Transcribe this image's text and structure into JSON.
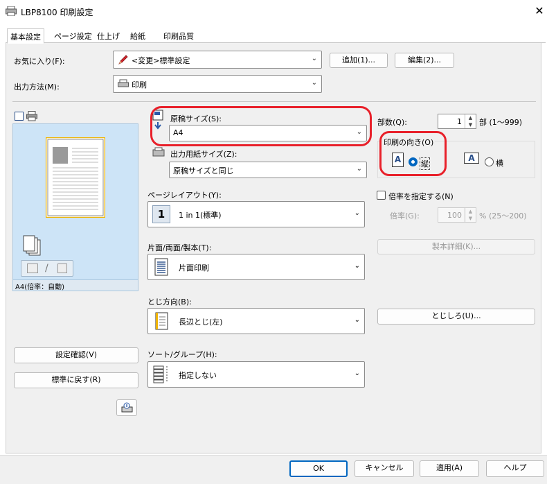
{
  "window": {
    "title": "LBP8100 印刷設定",
    "close_symbol": "✕"
  },
  "tabs": [
    "基本設定",
    "ページ設定",
    "仕上げ",
    "給紙",
    "印刷品質"
  ],
  "favorites": {
    "label": "お気に入り(F):",
    "value": "<変更>標準設定",
    "add_button": "追加(1)...",
    "edit_button": "編集(2)..."
  },
  "output_method": {
    "label": "出力方法(M):",
    "value": "印刷"
  },
  "preview": {
    "caption": "A4(倍率：自動)",
    "n_up_icons": "/ "
  },
  "left_buttons": {
    "confirm": "設定確認(V)",
    "restore": "標準に戻す(R)"
  },
  "paper": {
    "original_size_label": "原稿サイズ(S):",
    "original_size_value": "A4",
    "output_size_label": "出力用紙サイズ(Z):",
    "output_size_value": "原稿サイズと同じ"
  },
  "page_layout": {
    "label": "ページレイアウト(Y):",
    "icon_text": "1",
    "value": "1 in 1(標準)"
  },
  "duplex": {
    "label": "片面/両面/製本(T):",
    "value": "片面印刷"
  },
  "binding": {
    "label": "とじ方向(B):",
    "value": "長辺とじ(左)"
  },
  "sort": {
    "label": "ソート/グループ(H):",
    "value": "指定しない"
  },
  "copies": {
    "label": "部数(Q):",
    "value": "1",
    "unit": "部 (1〜999)"
  },
  "orientation": {
    "label": "印刷の向き(O)",
    "portrait": "縦",
    "landscape": "横",
    "selected": "portrait",
    "glyph": "A"
  },
  "scaling": {
    "checkbox_label": "倍率を指定する(N)",
    "checked": false,
    "label": "倍率(G):",
    "value": "100",
    "unit": "% (25〜200)"
  },
  "bookbinding_details": "製本詳細(K)...",
  "gutter": "とじしろ(U)...",
  "footer": {
    "ok": "OK",
    "cancel": "キャンセル",
    "apply": "適用(A)",
    "help": "ヘルプ"
  },
  "colors": {
    "accent": "#0067c0",
    "highlight": "#e8202a",
    "preview_bg": "#cde4f7",
    "paper_edge": "#f0b400"
  }
}
